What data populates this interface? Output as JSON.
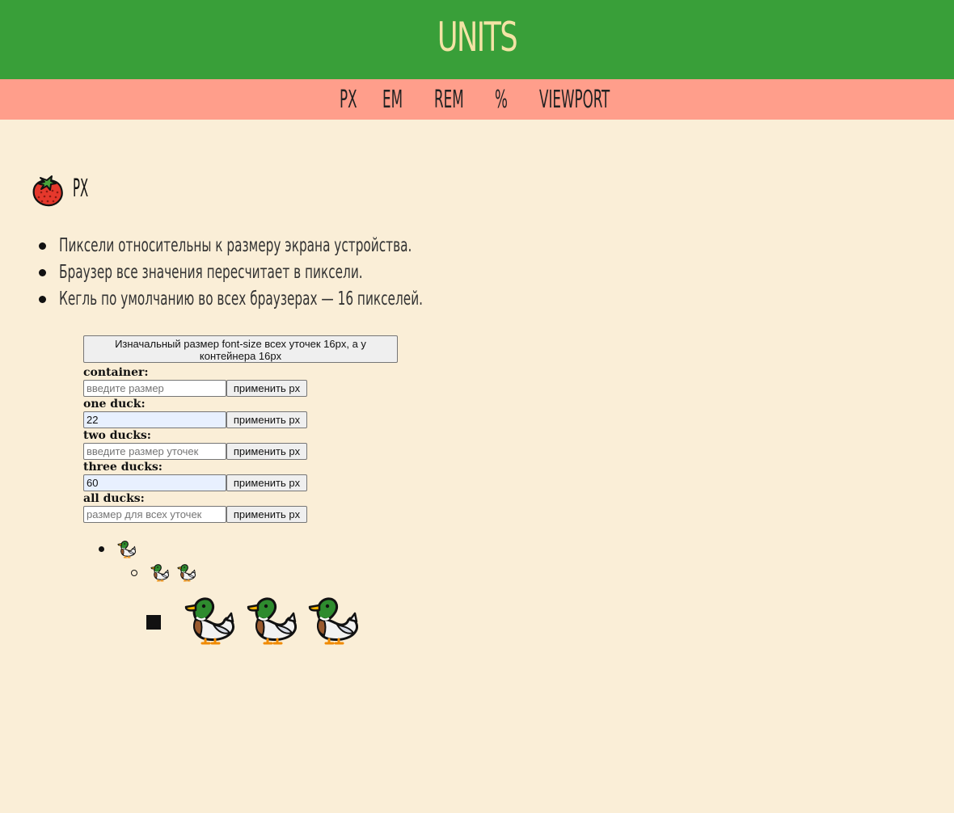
{
  "header": {
    "title": "UNITS",
    "background": "#399f39",
    "title_color": "#f3e3a5"
  },
  "nav": {
    "background": "#ff9e8b",
    "links": [
      {
        "label": "PX"
      },
      {
        "label": "EM"
      },
      {
        "label": "REM"
      },
      {
        "label": "%"
      },
      {
        "label": "VIEWPORT"
      }
    ]
  },
  "section": {
    "icon": "strawberry-icon",
    "title": "PX",
    "facts": [
      "Пиксели относительны к размеру экрана устройства.",
      "Браузер все значения пересчитает в пиксели.",
      "Кегль по умолчанию во всех браузерах — 16 пикселей."
    ]
  },
  "controls": {
    "info_button": "Изначальный размер font-size всех уточек 16px, а у контейнера 16px",
    "button_label": "применить px",
    "fields": [
      {
        "label": "container:",
        "value": "",
        "placeholder": "введите размер"
      },
      {
        "label": "one duck:",
        "value": "22",
        "placeholder": ""
      },
      {
        "label": "two ducks:",
        "value": "",
        "placeholder": "введите размер уточек"
      },
      {
        "label": "three ducks:",
        "value": "60",
        "placeholder": ""
      },
      {
        "label": "all ducks:",
        "value": "",
        "placeholder": "размер для всех уточек"
      }
    ]
  },
  "ducks": {
    "icon": "duck-icon",
    "levels": [
      {
        "bullet": "disc",
        "count": 1
      },
      {
        "bullet": "circle",
        "count": 2
      },
      {
        "bullet": "square",
        "count": 3
      }
    ]
  }
}
